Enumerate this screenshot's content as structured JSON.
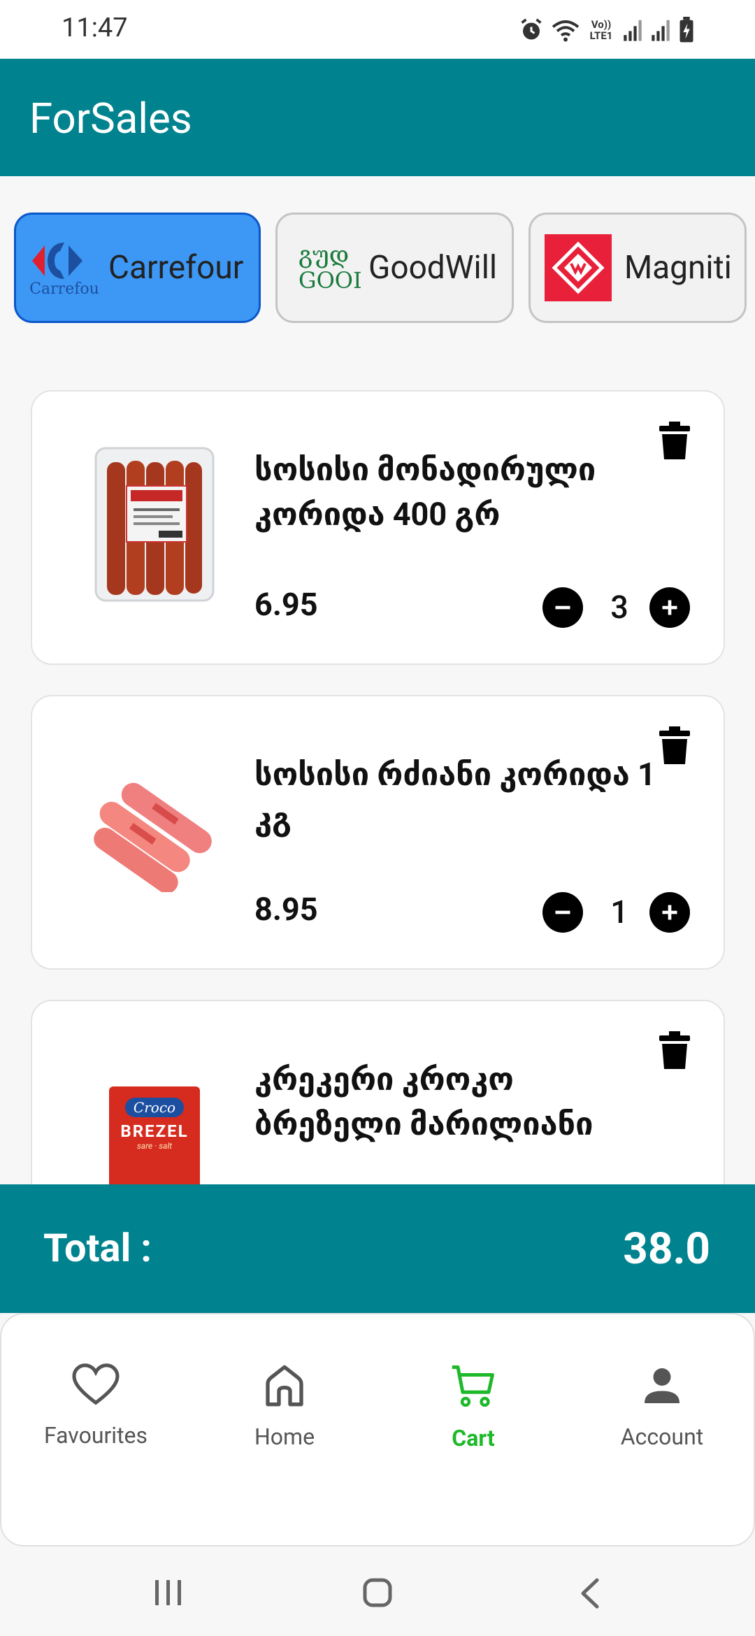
{
  "status_bar": {
    "time": "11:47",
    "network_label": "Vo)) LTE1",
    "icons": [
      "alarm-icon",
      "wifi-icon",
      "signal-icon",
      "signal-icon",
      "battery-charging-icon"
    ]
  },
  "app_bar": {
    "title": "ForSales"
  },
  "stores": [
    {
      "name": "Carrefour",
      "logo": "carrefour-logo",
      "logo_text": "Carrefou",
      "selected": true
    },
    {
      "name": "GoodWill",
      "logo": "goodwill-logo",
      "logo_text_1": "გუდ",
      "logo_text_2": "GOOI",
      "selected": false
    },
    {
      "name": "Magniti",
      "logo": "magniti-logo",
      "selected": false
    }
  ],
  "cart_items": [
    {
      "name": "სოსისი მონადირული კორიდა 400 გრ",
      "price": "6.95",
      "quantity": "3",
      "image": "smoked-sausages-pack"
    },
    {
      "name": "სოსისი რძიანი კორიდა 1 კგ",
      "price": "8.95",
      "quantity": "1",
      "image": "milk-sausages"
    },
    {
      "name": "კრეკერი კროკო ბრეზელი მარილიანი",
      "price": "",
      "quantity": "",
      "image": "croco-brezel-pack",
      "brand": "Croco",
      "product": "BREZEL",
      "flavor": "sare · salt"
    }
  ],
  "total": {
    "label": "Total :",
    "value": "38.0"
  },
  "bottom_nav": [
    {
      "label": "Favourites",
      "icon": "heart-icon",
      "active": false
    },
    {
      "label": "Home",
      "icon": "home-icon",
      "active": false
    },
    {
      "label": "Cart",
      "icon": "cart-icon",
      "active": true
    },
    {
      "label": "Account",
      "icon": "person-icon",
      "active": false
    }
  ],
  "colors": {
    "primary": "#00838f",
    "selected_store": "#3d98f5",
    "selected_store_border": "#0b57c9",
    "active_nav": "#1db92a",
    "magniti_red": "#e8203a"
  }
}
